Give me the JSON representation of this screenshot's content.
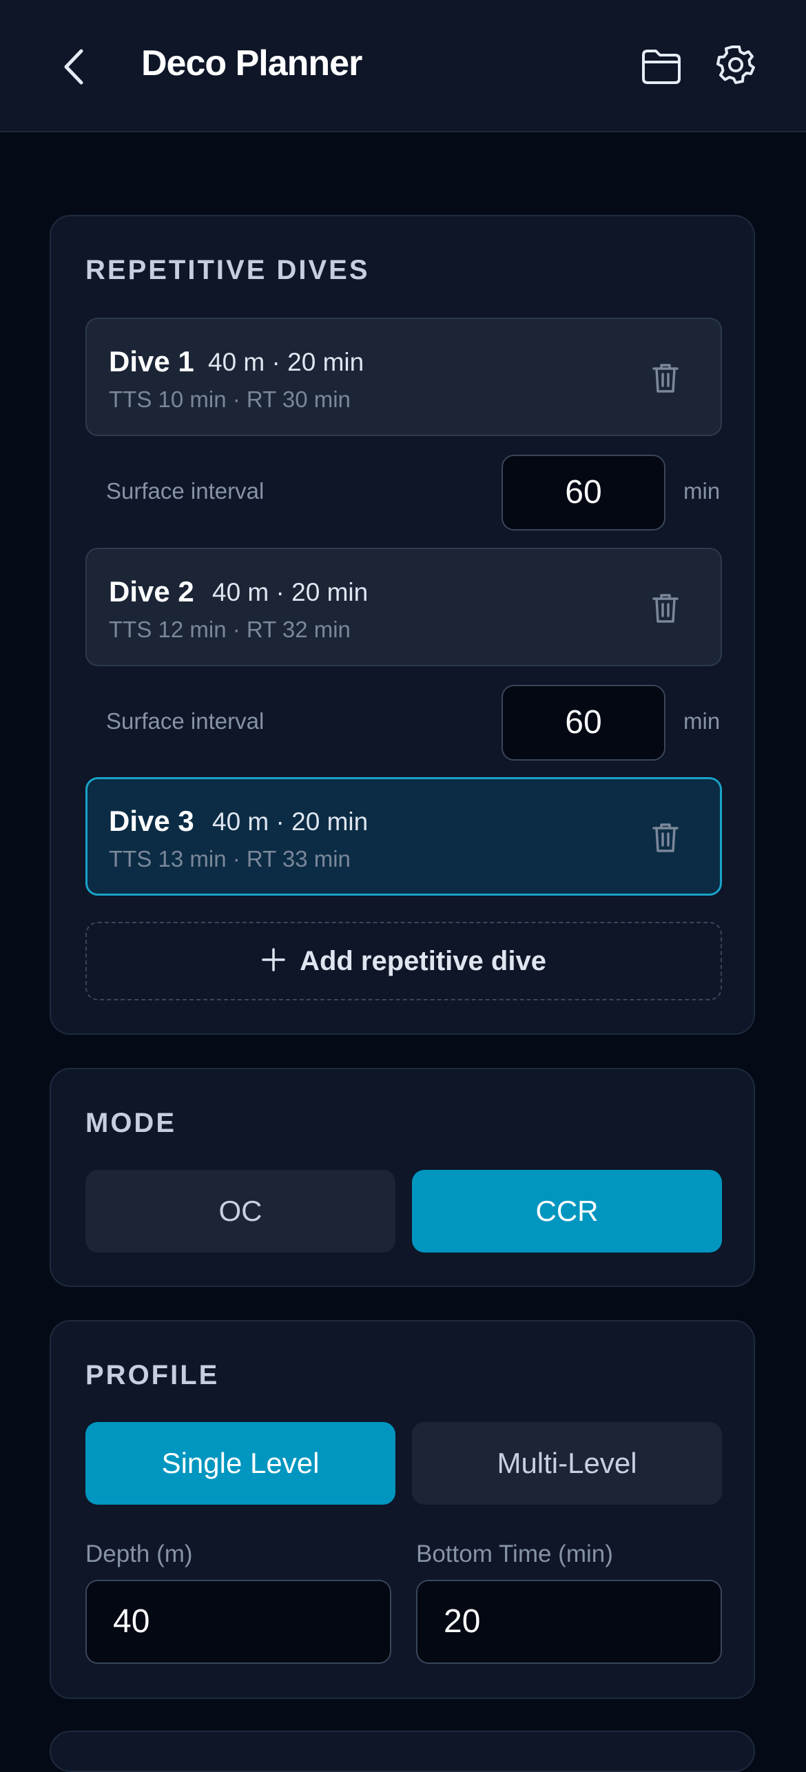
{
  "header": {
    "title": "Deco Planner",
    "icons": [
      "chevron-left-icon",
      "folder-icon",
      "gear-icon"
    ]
  },
  "repetitive": {
    "title": "REPETITIVE DIVES",
    "dives": [
      {
        "name": "Dive 1",
        "meta": "40 m · 20 min",
        "sub": "TTS 10 min · RT 30 min",
        "active": false
      },
      {
        "name": "Dive 2",
        "meta": "40 m · 20 min",
        "sub": "TTS 12 min · RT 32 min",
        "active": false
      },
      {
        "name": "Dive 3",
        "meta": "40 m · 20 min",
        "sub": "TTS 13 min · RT 33 min",
        "active": true
      }
    ],
    "intervals": [
      {
        "label": "Surface interval",
        "value": "60",
        "unit": "min"
      },
      {
        "label": "Surface interval",
        "value": "60",
        "unit": "min"
      }
    ],
    "add_label": "Add repetitive dive"
  },
  "mode": {
    "title": "MODE",
    "options": [
      "OC",
      "CCR"
    ],
    "selected": "CCR"
  },
  "profile": {
    "title": "PROFILE",
    "options": [
      "Single Level",
      "Multi-Level"
    ],
    "selected": "Single Level",
    "depth_label": "Depth (m)",
    "depth_value": "40",
    "time_label": "Bottom Time (min)",
    "time_value": "20"
  },
  "colors": {
    "accent": "#0096bf",
    "active_border": "#1aa3c9",
    "background": "#050b16",
    "card": "#0e1628"
  }
}
